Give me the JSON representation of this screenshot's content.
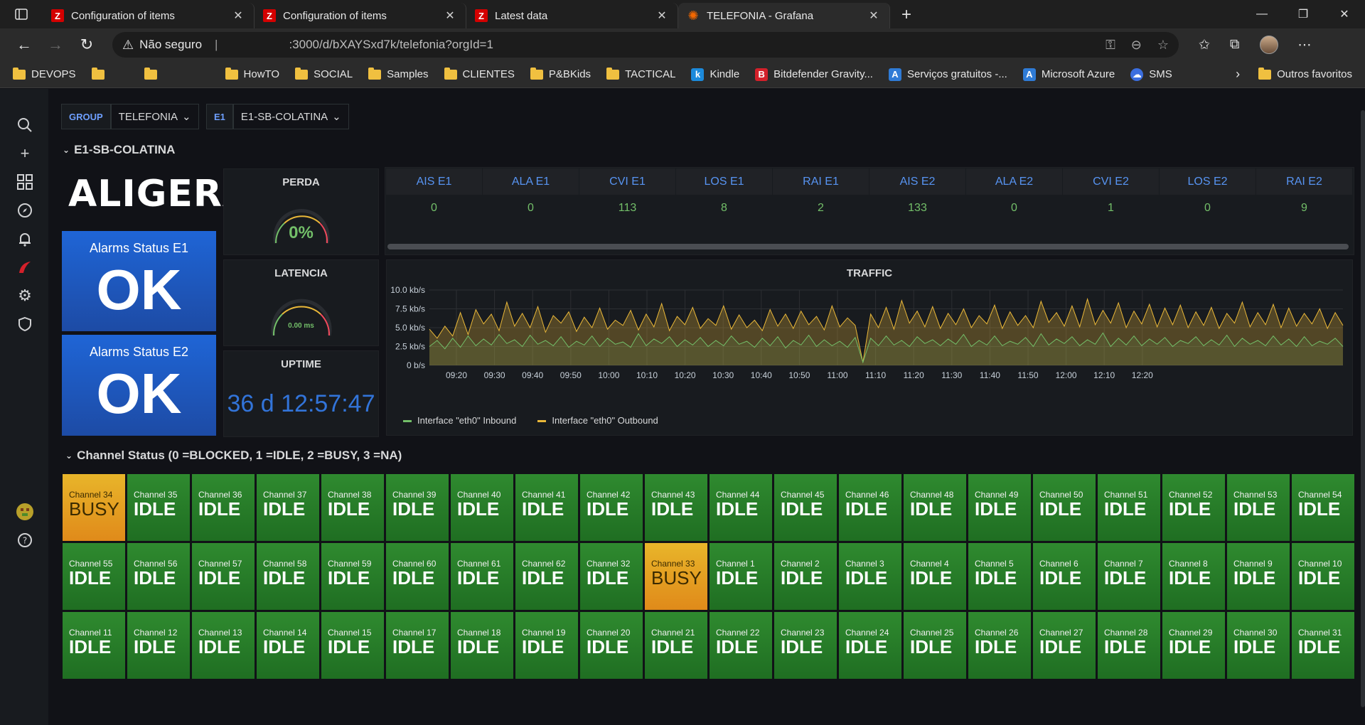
{
  "browser": {
    "tabs": [
      {
        "title": "Configuration of items",
        "icon": "Z",
        "active": false
      },
      {
        "title": "Configuration of items",
        "icon": "Z",
        "active": false
      },
      {
        "title": "Latest data",
        "icon": "Z",
        "active": false
      },
      {
        "title": "TELEFONIA - Grafana",
        "icon": "grafana",
        "active": true
      }
    ],
    "address": {
      "security_label": "Não seguro",
      "separator": "|",
      "url": ":3000/d/bXAYSxd7k/telefonia?orgId=1"
    },
    "bookmarks": [
      {
        "label": "DEVOPS",
        "type": "folder"
      },
      {
        "label": "",
        "type": "folder"
      },
      {
        "label": "",
        "type": "folder"
      },
      {
        "label": "HowTO",
        "type": "folder"
      },
      {
        "label": "SOCIAL",
        "type": "folder"
      },
      {
        "label": "Samples",
        "type": "folder"
      },
      {
        "label": "CLIENTES",
        "type": "folder"
      },
      {
        "label": "P&BKids",
        "type": "folder"
      },
      {
        "label": "TACTICAL",
        "type": "folder"
      },
      {
        "label": "Kindle",
        "type": "site",
        "icon": "k",
        "color": "#1c8adb"
      },
      {
        "label": "Bitdefender Gravity...",
        "type": "site",
        "icon": "B",
        "color": "#d4202a"
      },
      {
        "label": "Serviços gratuitos -...",
        "type": "site",
        "icon": "A",
        "color": "#2f7bd6"
      },
      {
        "label": "Microsoft Azure",
        "type": "site",
        "icon": "A",
        "color": "#2f7bd6"
      },
      {
        "label": "SMS",
        "type": "site",
        "icon": "☁",
        "color": "#3b6ee0"
      }
    ],
    "other_favorites": "Outros favoritos"
  },
  "dashboard": {
    "variables": [
      {
        "label": "GROUP",
        "value": "TELEFONIA"
      },
      {
        "label": "E1",
        "value": "E1-SB-COLATINA"
      }
    ],
    "row1_title": "E1-SB-COLATINA",
    "logo_text": "ALIGERA",
    "alarm_e1": {
      "title": "Alarms Status E1",
      "value": "OK"
    },
    "alarm_e2": {
      "title": "Alarms Status E2",
      "value": "OK"
    },
    "perda": {
      "title": "PERDA",
      "value": "0%",
      "fraction": 0
    },
    "latencia": {
      "title": "LATENCIA",
      "value": "0.00 ms",
      "fraction": 0
    },
    "uptime": {
      "title": "UPTIME",
      "value": "36 d 12:57:47"
    },
    "alarm_table": {
      "headers": [
        "AIS E1",
        "ALA E1",
        "CVI E1",
        "LOS E1",
        "RAI E1",
        "AIS E2",
        "ALA E2",
        "CVI E2",
        "LOS E2",
        "RAI E2"
      ],
      "values": [
        "0",
        "0",
        "113",
        "8",
        "2",
        "133",
        "0",
        "1",
        "0",
        "9"
      ]
    },
    "row2_title": "Channel Status (0 =BLOCKED, 1 =IDLE, 2 =BUSY, 3 =NA)",
    "channels": [
      [
        "Channel 34",
        "BUSY"
      ],
      [
        "Channel 35",
        "IDLE"
      ],
      [
        "Channel 36",
        "IDLE"
      ],
      [
        "Channel 37",
        "IDLE"
      ],
      [
        "Channel 38",
        "IDLE"
      ],
      [
        "Channel 39",
        "IDLE"
      ],
      [
        "Channel 40",
        "IDLE"
      ],
      [
        "Channel 41",
        "IDLE"
      ],
      [
        "Channel 42",
        "IDLE"
      ],
      [
        "Channel 43",
        "IDLE"
      ],
      [
        "Channel 44",
        "IDLE"
      ],
      [
        "Channel 45",
        "IDLE"
      ],
      [
        "Channel 46",
        "IDLE"
      ],
      [
        "Channel 48",
        "IDLE"
      ],
      [
        "Channel 49",
        "IDLE"
      ],
      [
        "Channel 50",
        "IDLE"
      ],
      [
        "Channel 51",
        "IDLE"
      ],
      [
        "Channel 52",
        "IDLE"
      ],
      [
        "Channel 53",
        "IDLE"
      ],
      [
        "Channel 54",
        "IDLE"
      ],
      [
        "Channel 55",
        "IDLE"
      ],
      [
        "Channel 56",
        "IDLE"
      ],
      [
        "Channel 57",
        "IDLE"
      ],
      [
        "Channel 58",
        "IDLE"
      ],
      [
        "Channel 59",
        "IDLE"
      ],
      [
        "Channel 60",
        "IDLE"
      ],
      [
        "Channel 61",
        "IDLE"
      ],
      [
        "Channel 62",
        "IDLE"
      ],
      [
        "Channel 32",
        "IDLE"
      ],
      [
        "Channel 33",
        "BUSY"
      ],
      [
        "Channel 1",
        "IDLE"
      ],
      [
        "Channel 2",
        "IDLE"
      ],
      [
        "Channel 3",
        "IDLE"
      ],
      [
        "Channel 4",
        "IDLE"
      ],
      [
        "Channel 5",
        "IDLE"
      ],
      [
        "Channel 6",
        "IDLE"
      ],
      [
        "Channel 7",
        "IDLE"
      ],
      [
        "Channel 8",
        "IDLE"
      ],
      [
        "Channel 9",
        "IDLE"
      ],
      [
        "Channel 10",
        "IDLE"
      ],
      [
        "Channel 11",
        "IDLE"
      ],
      [
        "Channel 12",
        "IDLE"
      ],
      [
        "Channel 13",
        "IDLE"
      ],
      [
        "Channel 14",
        "IDLE"
      ],
      [
        "Channel 15",
        "IDLE"
      ],
      [
        "Channel 17",
        "IDLE"
      ],
      [
        "Channel 18",
        "IDLE"
      ],
      [
        "Channel 19",
        "IDLE"
      ],
      [
        "Channel 20",
        "IDLE"
      ],
      [
        "Channel 21",
        "IDLE"
      ],
      [
        "Channel 22",
        "IDLE"
      ],
      [
        "Channel 23",
        "IDLE"
      ],
      [
        "Channel 24",
        "IDLE"
      ],
      [
        "Channel 25",
        "IDLE"
      ],
      [
        "Channel 26",
        "IDLE"
      ],
      [
        "Channel 27",
        "IDLE"
      ],
      [
        "Channel 28",
        "IDLE"
      ],
      [
        "Channel 29",
        "IDLE"
      ],
      [
        "Channel 30",
        "IDLE"
      ],
      [
        "Channel 31",
        "IDLE"
      ]
    ],
    "colors": {
      "idle": "#299c46",
      "busy": "#e5a825",
      "inbound": "#73bf69",
      "outbound": "#eab839",
      "accent": "#3274d9"
    }
  },
  "chart_data": {
    "type": "area",
    "title": "TRAFFIC",
    "x_ticks": [
      "09:20",
      "09:30",
      "09:40",
      "09:50",
      "10:00",
      "10:10",
      "10:20",
      "10:30",
      "10:40",
      "10:50",
      "11:00",
      "11:10",
      "11:20",
      "11:30",
      "11:40",
      "11:50",
      "12:00",
      "12:10",
      "12:20"
    ],
    "y_ticks": [
      "0 b/s",
      "2.5 kb/s",
      "5.0 kb/s",
      "7.5 kb/s",
      "10.0 kb/s"
    ],
    "ylim": [
      0,
      10
    ],
    "y_unit": "kb/s",
    "grid": true,
    "legend_position": "bottom-left",
    "series": [
      {
        "name": "Interface \"eth0\" Inbound",
        "color": "#73bf69",
        "values": [
          2.5,
          3.3,
          2.2,
          3.6,
          2.4,
          3.9,
          2.6,
          3.5,
          2.7,
          4.1,
          2.9,
          3.4,
          2.5,
          4.0,
          2.8,
          3.3,
          2.6,
          3.8,
          2.4,
          3.2,
          2.7,
          3.9,
          2.5,
          3.6,
          2.8,
          3.1,
          2.4,
          4.2,
          2.6,
          3.5,
          2.9,
          3.8,
          2.5,
          3.4,
          2.7,
          3.7,
          2.5,
          3.3,
          2.6,
          3.9,
          2.8,
          3.2,
          2.4,
          3.6,
          2.6,
          3.8,
          2.3,
          3.3,
          2.7,
          4.0,
          2.5,
          3.4,
          2.6,
          3.2,
          2.4,
          3.7,
          0.4,
          3.6,
          2.6,
          3.9,
          2.7,
          3.3,
          2.5,
          3.8,
          2.9,
          3.4,
          2.6,
          3.5,
          2.8,
          4.1,
          2.5,
          3.3,
          2.7,
          3.9,
          2.6,
          3.2,
          2.8,
          3.7,
          2.5,
          4.2,
          2.7,
          3.5,
          2.9,
          3.8,
          2.6,
          3.4,
          2.8,
          4.3,
          2.5,
          3.6,
          2.7,
          3.9,
          2.6,
          3.5,
          2.8,
          3.7,
          2.5,
          3.3,
          2.9,
          3.8,
          2.6,
          3.4,
          2.7,
          4.0,
          2.5,
          3.6,
          2.8,
          3.3,
          2.6,
          3.9,
          2.7,
          3.5,
          2.5,
          3.8,
          2.6,
          3.2,
          2.8,
          3.6,
          2.5
        ]
      },
      {
        "name": "Interface \"eth0\" Outbound",
        "color": "#eab839",
        "values": [
          4.8,
          3.6,
          5.2,
          3.9,
          7.0,
          4.1,
          7.4,
          5.5,
          6.8,
          4.6,
          8.4,
          5.2,
          6.9,
          5.0,
          7.8,
          4.4,
          6.6,
          5.6,
          7.1,
          4.5,
          6.4,
          5.0,
          7.6,
          4.8,
          6.0,
          5.3,
          7.3,
          4.7,
          6.8,
          5.1,
          8.2,
          4.6,
          6.5,
          5.4,
          7.7,
          4.9,
          6.2,
          5.3,
          7.9,
          4.8,
          6.7,
          5.0,
          6.0,
          4.6,
          7.4,
          5.2,
          6.8,
          4.9,
          7.2,
          5.4,
          6.5,
          4.7,
          7.9,
          5.1,
          6.3,
          5.3,
          0.4,
          6.8,
          5.0,
          7.7,
          4.8,
          8.6,
          5.6,
          7.2,
          5.1,
          7.8,
          4.9,
          6.9,
          5.4,
          7.5,
          5.0,
          6.6,
          5.5,
          8.0,
          4.9,
          7.1,
          5.3,
          6.6,
          5.0,
          8.5,
          5.7,
          7.0,
          5.2,
          7.9,
          5.1,
          8.8,
          5.4,
          7.3,
          5.6,
          8.3,
          5.0,
          7.2,
          5.5,
          8.1,
          5.1,
          7.6,
          5.4,
          8.0,
          5.0,
          7.1,
          5.3,
          7.7,
          4.9,
          6.9,
          5.6,
          8.4,
          5.1,
          7.0,
          5.4,
          8.1,
          5.0,
          7.6,
          5.2,
          6.9,
          5.5,
          7.5,
          4.9,
          7.0,
          5.3
        ]
      }
    ]
  }
}
